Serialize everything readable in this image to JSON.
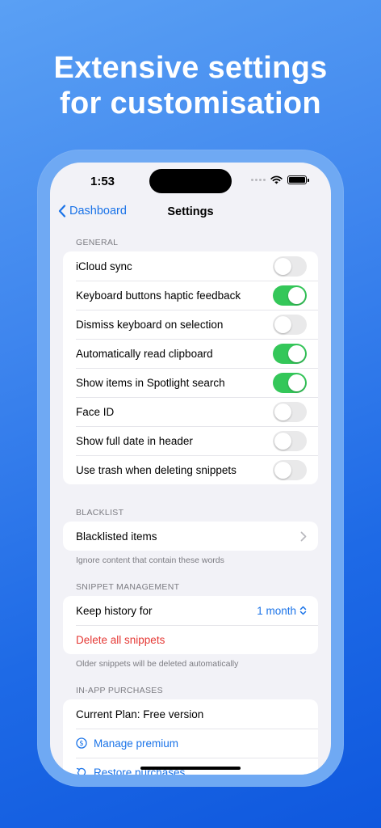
{
  "headline": {
    "line1": "Extensive settings",
    "line2": "for customisation"
  },
  "status_bar": {
    "time": "1:53"
  },
  "nav": {
    "back_label": "Dashboard",
    "title": "Settings"
  },
  "general": {
    "header": "GENERAL",
    "items": [
      {
        "label": "iCloud sync",
        "on": false
      },
      {
        "label": "Keyboard buttons haptic feedback",
        "on": true
      },
      {
        "label": "Dismiss keyboard on selection",
        "on": false
      },
      {
        "label": "Automatically read clipboard",
        "on": true
      },
      {
        "label": "Show items in Spotlight search",
        "on": true
      },
      {
        "label": "Face ID",
        "on": false
      },
      {
        "label": "Show full date in header",
        "on": false
      },
      {
        "label": "Use trash when deleting snippets",
        "on": false
      }
    ]
  },
  "blacklist": {
    "header": "BLACKLIST",
    "item_label": "Blacklisted items",
    "footer": "Ignore content that contain these words"
  },
  "snippet_management": {
    "header": "SNIPPET MANAGEMENT",
    "keep_history_label": "Keep history for",
    "keep_history_value": "1 month",
    "delete_label": "Delete all snippets",
    "footer": "Older snippets will be deleted automatically"
  },
  "in_app_purchases": {
    "header": "IN-APP PURCHASES",
    "current_plan": "Current Plan: Free version",
    "manage_premium": "Manage premium",
    "restore_purchases": "Restore purchases"
  },
  "colors": {
    "accent": "#1a73e8",
    "toggle_on": "#34c759",
    "danger": "#e53935"
  }
}
